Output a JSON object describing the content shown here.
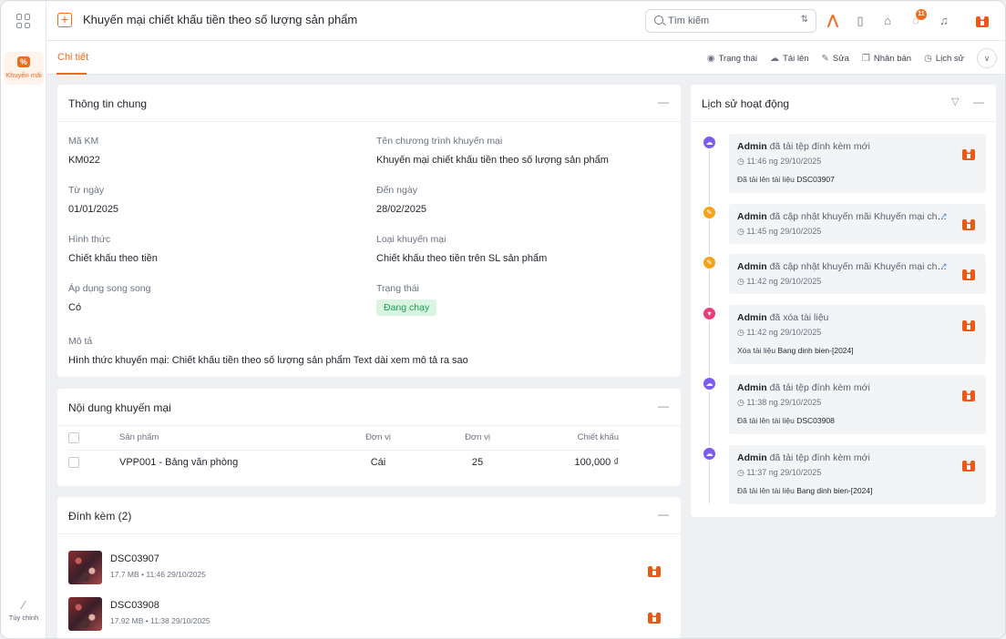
{
  "rail": {
    "module_label": "Khuyến mãi",
    "custom_label": "Tùy chỉnh"
  },
  "header": {
    "title": "Khuyến mại chiết khấu tiền theo số lượng sản phẩm",
    "search_placeholder": "Tìm kiếm",
    "notification_count": "11"
  },
  "tabs": {
    "detail": "Chi tiết"
  },
  "actions": {
    "status": "Trạng thái",
    "upload": "Tải lên",
    "edit": "Sửa",
    "duplicate": "Nhân bản",
    "history": "Lịch sử"
  },
  "general": {
    "title": "Thông tin chung",
    "code_label": "Mã KM",
    "code_value": "KM022",
    "name_label": "Tên chương trình khuyến mại",
    "name_value": "Khuyến mại chiết khấu tiền theo số lượng sản phẩm",
    "from_label": "Từ ngày",
    "from_value": "01/01/2025",
    "to_label": "Đến ngày",
    "to_value": "28/02/2025",
    "form_label": "Hình thức",
    "form_value": "Chiết khấu theo tiền",
    "type_label": "Loại khuyến mại",
    "type_value": "Chiết khấu theo tiền trên SL sản phẩm",
    "parallel_label": "Áp dụng song song",
    "parallel_value": "Có",
    "status_label": "Trạng thái",
    "status_value": "Đang chạy",
    "desc_label": "Mô tả",
    "desc_value": "Hình thức khuyến mại: Chiết khấu tiền theo số lượng sản phẩm Text dài xem mô tả ra sao"
  },
  "content": {
    "title": "Nội dung khuyến mại",
    "columns": [
      "Sản phẩm",
      "Đơn vị",
      "Đơn vị",
      "Chiết khấu"
    ],
    "rows": [
      {
        "product": "VPP001 - Bảng văn phòng",
        "unit": "Cái",
        "qty": "25",
        "discount": "100,000 ₫"
      }
    ]
  },
  "attachments": {
    "title": "Đính kèm (2)",
    "items": [
      {
        "name": "DSC03907",
        "size": "17.7 MB",
        "time": "11:46 29/10/2025"
      },
      {
        "name": "DSC03908",
        "size": "17.92 MB",
        "time": "11:38 29/10/2025"
      }
    ]
  },
  "activity": {
    "title": "Lịch sử hoạt động",
    "items": [
      {
        "user": "Admin",
        "action": "đã tải tệp đính kèm mới",
        "time": "11:46 ng 29/10/2025",
        "detail_prefix": "Đã tải lên tài liệu",
        "detail_target": "DSC03907"
      },
      {
        "user": "Admin",
        "action": "đã cập nhật khuyến mãi Khuyến mại chi...",
        "time": "11:45 ng 29/10/2025",
        "detail_prefix": "",
        "detail_target": ""
      },
      {
        "user": "Admin",
        "action": "đã cập nhật khuyến mãi Khuyến mại chi...",
        "time": "11:42 ng 29/10/2025",
        "detail_prefix": "",
        "detail_target": ""
      },
      {
        "user": "Admin",
        "action": "đã xóa tài liệu",
        "time": "11:42 ng 29/10/2025",
        "detail_prefix": "Xóa tài liệu",
        "detail_target": "Bang dinh bien-[2024]"
      },
      {
        "user": "Admin",
        "action": "đã tải tệp đính kèm mới",
        "time": "11:38 ng 29/10/2025",
        "detail_prefix": "Đã tải lên tài liệu",
        "detail_target": "DSC03908"
      },
      {
        "user": "Admin",
        "action": "đã tải tệp đính kèm mới",
        "time": "11:37 ng 29/10/2025",
        "detail_prefix": "Đã tải lên tài liệu",
        "detail_target": "Bang dinh bien-[2024]"
      }
    ]
  },
  "colors": {
    "accent": "#f26b1d",
    "status_green": "#1f9d55"
  }
}
